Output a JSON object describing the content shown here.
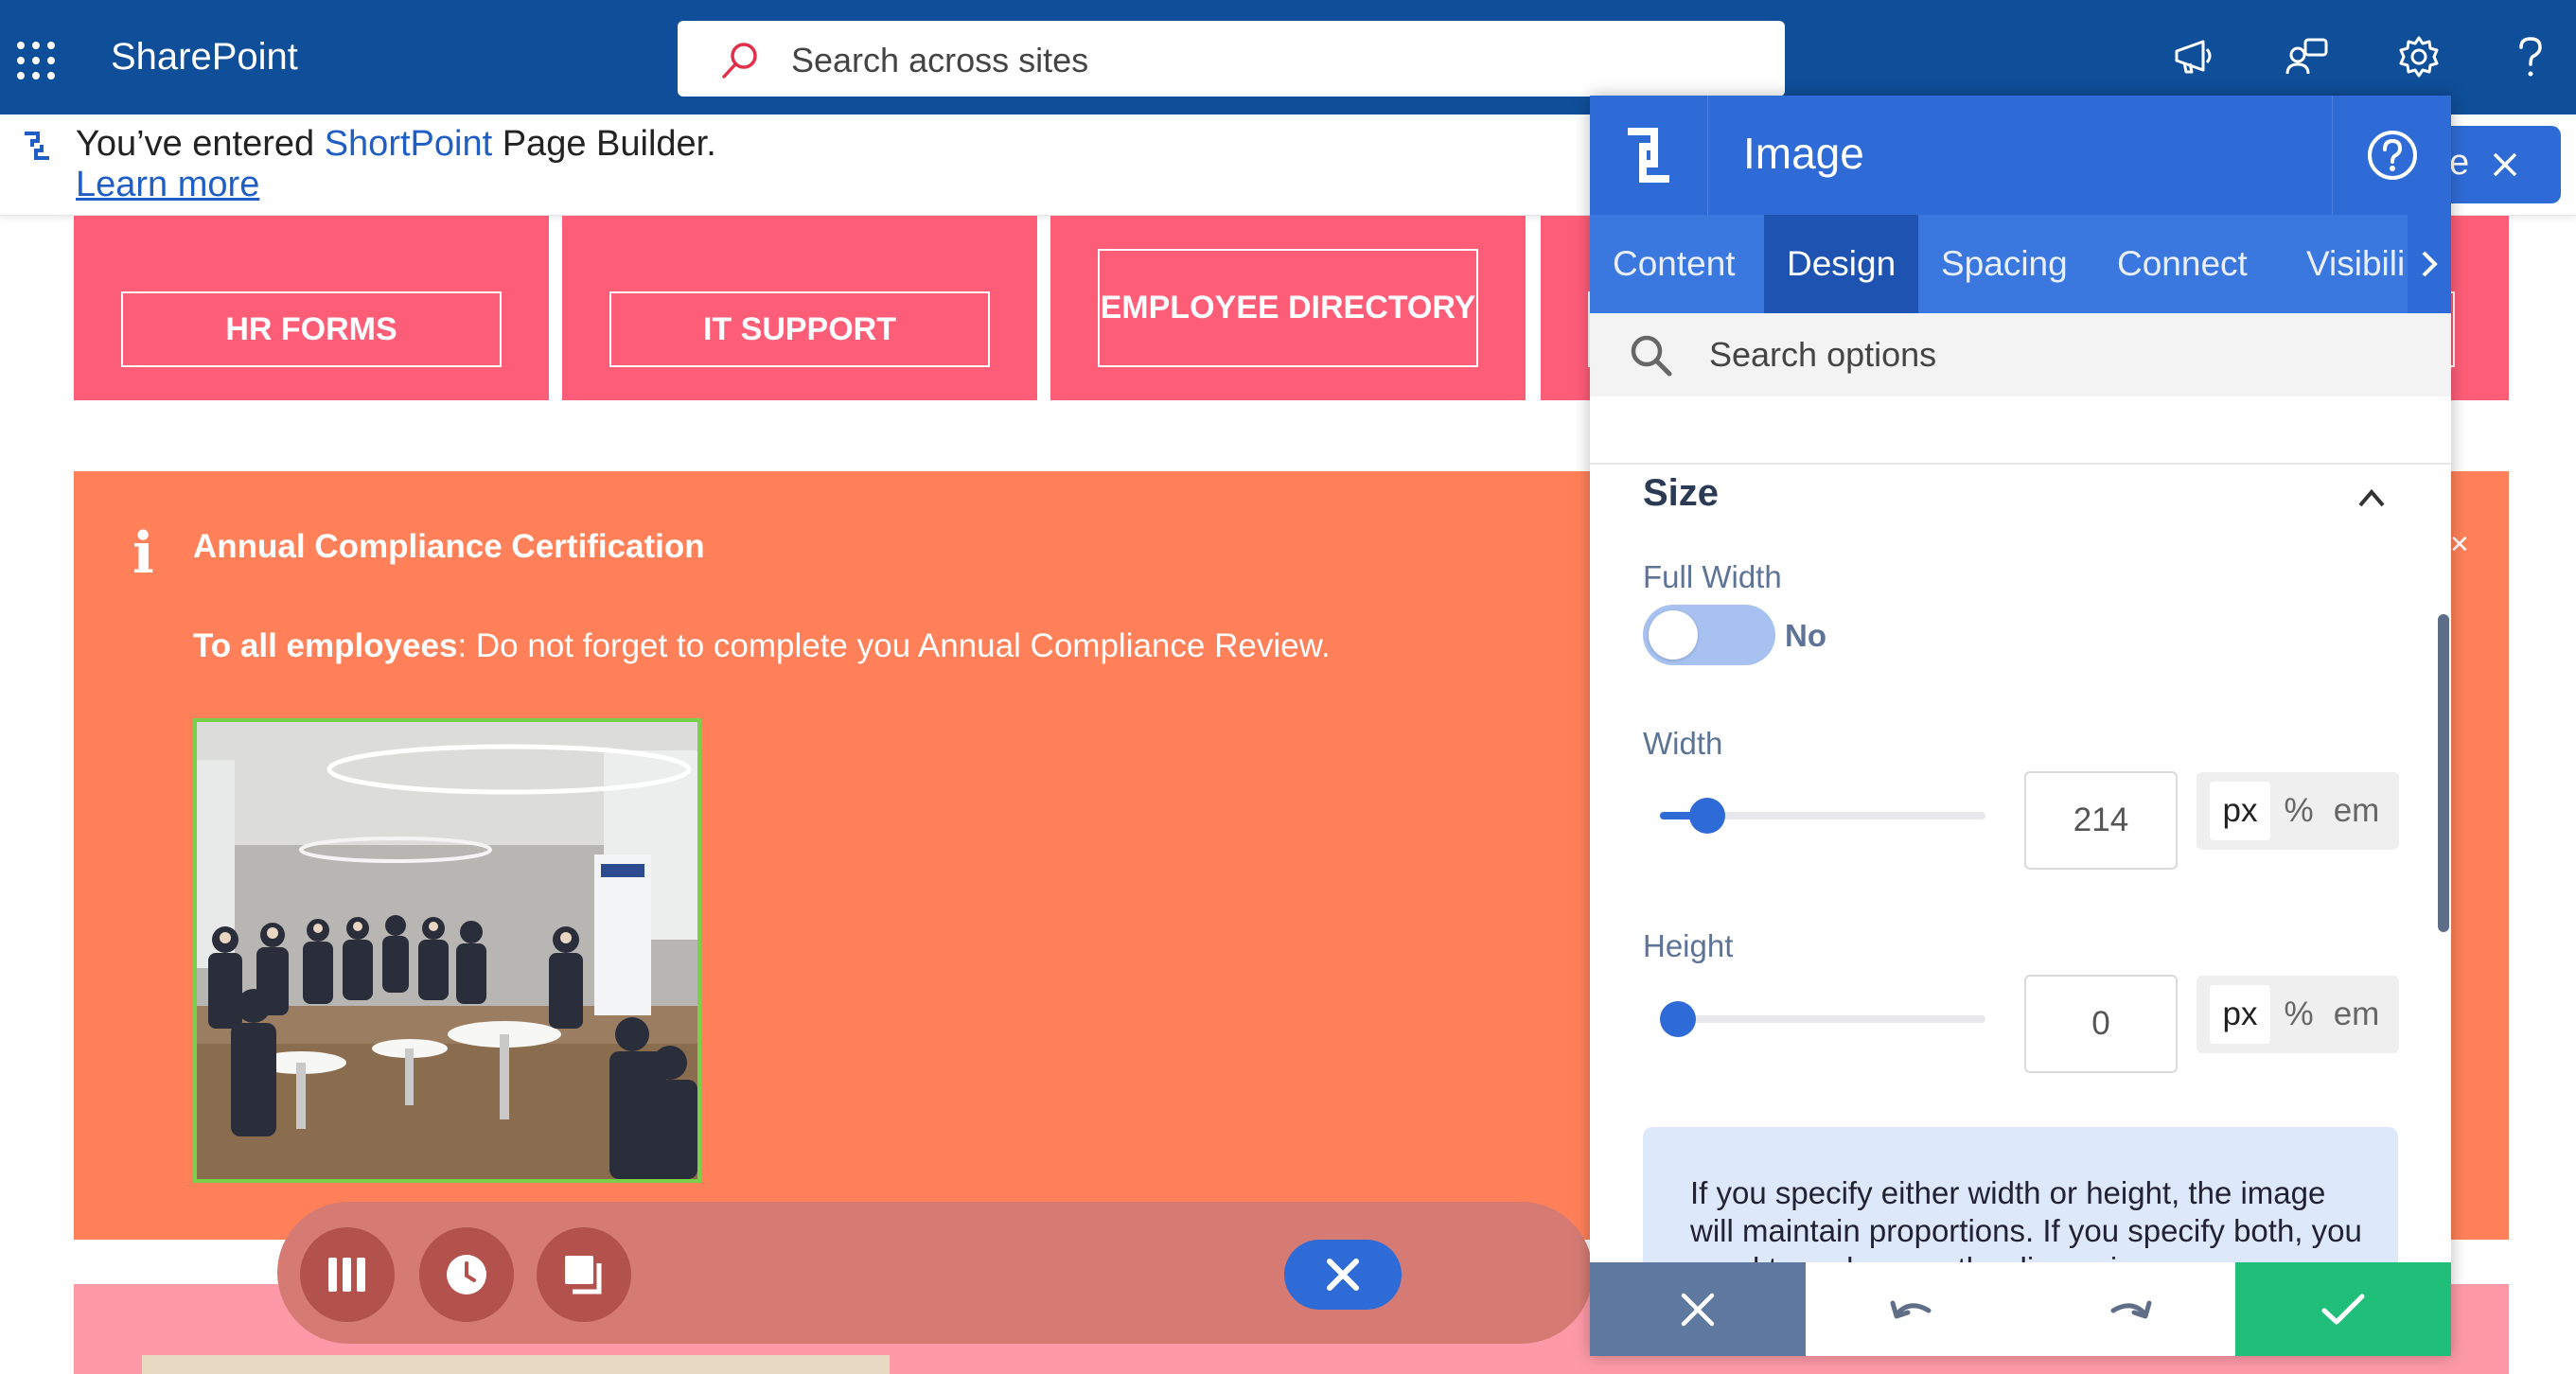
{
  "topbar": {
    "app_name": "SharePoint",
    "search_placeholder": "Search across sites"
  },
  "notice": {
    "prefix": "You’ve entered ",
    "product": "ShortPoint",
    "suffix": " Page Builder. ",
    "link": "Learn more"
  },
  "tiles": [
    {
      "label": "HR FORMS"
    },
    {
      "label": "IT SUPPORT"
    },
    {
      "label": "EMPLOYEE DIRECTORY"
    }
  ],
  "alert": {
    "icon": "i",
    "title": "Annual Compliance Certification",
    "body_bold": "To all employees",
    "body_rest": ": Do not forget  to complete you Annual Compliance Review."
  },
  "publish_button": {
    "label": "e"
  },
  "panel": {
    "title": "Image",
    "tabs": [
      {
        "label": "Content"
      },
      {
        "label": "Design"
      },
      {
        "label": "Spacing"
      },
      {
        "label": "Connect"
      },
      {
        "label": "Visibili"
      }
    ],
    "active_tab": "Design",
    "search_placeholder": "Search options",
    "section": {
      "title": "Size",
      "full_width": {
        "label": "Full Width",
        "state": "No",
        "enabled": false
      },
      "width": {
        "label": "Width",
        "value": "214",
        "slider_fraction": 0.1,
        "units": [
          "px",
          "%",
          "em"
        ],
        "selected_unit": "px"
      },
      "height": {
        "label": "Height",
        "value": "0",
        "slider_fraction": 0.0,
        "units": [
          "px",
          "%",
          "em"
        ],
        "selected_unit": "px"
      },
      "info": "If you specify either width or height, the image will maintain proportions. If you specify both, you need to make sure the dimensions"
    }
  },
  "colors": {
    "topbar": "#0f4e99",
    "accent": "#2f6bd6",
    "tile": "#fe5d78",
    "alert": "#ff8059",
    "confirm": "#1fbf7a"
  }
}
